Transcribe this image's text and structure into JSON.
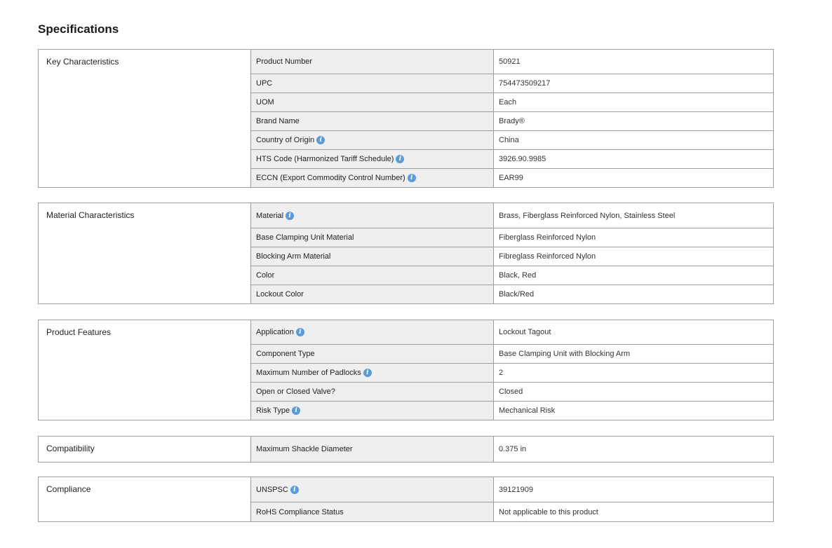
{
  "page_title": "Specifications",
  "sections": [
    {
      "label": "Key Characteristics",
      "rows": [
        {
          "name": "Product Number",
          "value": "50921",
          "info": false
        },
        {
          "name": "UPC",
          "value": "754473509217",
          "info": false
        },
        {
          "name": "UOM",
          "value": "Each",
          "info": false
        },
        {
          "name": "Brand Name",
          "value": "Brady®",
          "info": false
        },
        {
          "name": "Country of Origin",
          "value": "China",
          "info": true
        },
        {
          "name": "HTS Code (Harmonized Tariff Schedule)",
          "value": "3926.90.9985",
          "info": true
        },
        {
          "name": "ECCN (Export Commodity Control Number)",
          "value": "EAR99",
          "info": true
        }
      ]
    },
    {
      "label": "Material Characteristics",
      "rows": [
        {
          "name": "Material",
          "value": "Brass, Fiberglass Reinforced Nylon, Stainless Steel",
          "info": true
        },
        {
          "name": "Base Clamping Unit Material",
          "value": "Fiberglass Reinforced Nylon",
          "info": false
        },
        {
          "name": "Blocking Arm Material",
          "value": "Fibreglass Reinforced Nylon",
          "info": false
        },
        {
          "name": "Color",
          "value": "Black, Red",
          "info": false
        },
        {
          "name": "Lockout Color",
          "value": "Black/Red",
          "info": false
        }
      ]
    },
    {
      "label": "Product Features",
      "rows": [
        {
          "name": "Application",
          "value": "Lockout Tagout",
          "info": true
        },
        {
          "name": "Component Type",
          "value": "Base Clamping Unit with Blocking Arm",
          "info": false
        },
        {
          "name": "Maximum Number of Padlocks",
          "value": "2",
          "info": true
        },
        {
          "name": "Open or Closed Valve?",
          "value": "Closed",
          "info": false
        },
        {
          "name": "Risk Type",
          "value": "Mechanical Risk",
          "info": true
        }
      ]
    },
    {
      "label": "Compatibility",
      "rows": [
        {
          "name": "Maximum Shackle Diameter",
          "value": "0.375 in",
          "info": false
        }
      ]
    },
    {
      "label": "Compliance",
      "rows": [
        {
          "name": "UNSPSC",
          "value": "39121909",
          "info": true
        },
        {
          "name": "RoHS Compliance Status",
          "value": "Not applicable to this product",
          "info": false
        }
      ]
    }
  ],
  "icons": {
    "info": "info-icon",
    "info_glyph": "i",
    "info_color": "#5b9bd8"
  },
  "colors": {
    "label_cell_bg": "#efefef",
    "border": "#9e9e9e"
  }
}
